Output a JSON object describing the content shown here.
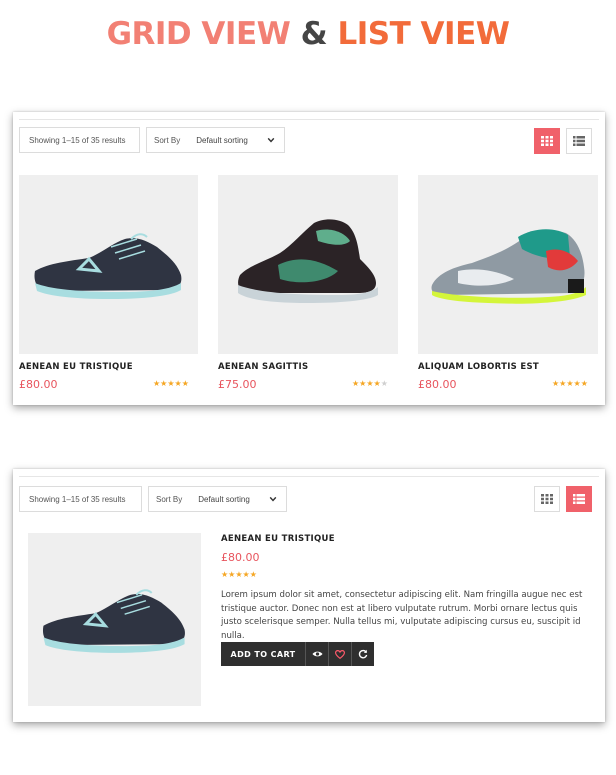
{
  "headline": {
    "grid_word": "GRID VIEW",
    "amp": "&",
    "list_word": "LIST VIEW"
  },
  "colors": {
    "accent": "#f0616a",
    "price": "#e8555e",
    "star": "#f5a623",
    "grid_word": "#f28074",
    "list_word": "#f26b3a",
    "button_dark": "#2f2f2f"
  },
  "grid_view": {
    "results_text": "Showing 1–15 of 35 results",
    "sort_label": "Sort By",
    "sort_value": "Default sorting",
    "active_view": "grid",
    "products": [
      {
        "name": "AENEAN EU TRISTIQUE",
        "price": "£80.00",
        "rating": 5,
        "icon": "running-shoe-icon"
      },
      {
        "name": "AENEAN SAGITTIS",
        "price": "£75.00",
        "rating": 4,
        "icon": "basketball-shoe-icon"
      },
      {
        "name": "ALIQUAM LOBORTIS EST",
        "price": "£80.00",
        "rating": 5,
        "icon": "colorful-shoe-icon"
      }
    ]
  },
  "list_view": {
    "results_text": "Showing 1–15 of 35 results",
    "sort_label": "Sort By",
    "sort_value": "Default sorting",
    "active_view": "list",
    "product": {
      "name": "AENEAN EU TRISTIQUE",
      "price": "£80.00",
      "rating": 5,
      "description": "Lorem ipsum dolor sit amet, consectetur adipiscing elit. Nam fringilla augue nec est tristique auctor. Donec non est at libero vulputate rutrum. Morbi ornare lectus quis justo scelerisque semper. Nulla tellus mi, vulputate adipiscing cursus eu, suscipit id nulla.",
      "add_to_cart_label": "ADD TO CART",
      "action_icons": [
        "eye-icon",
        "heart-icon",
        "refresh-icon"
      ]
    }
  }
}
